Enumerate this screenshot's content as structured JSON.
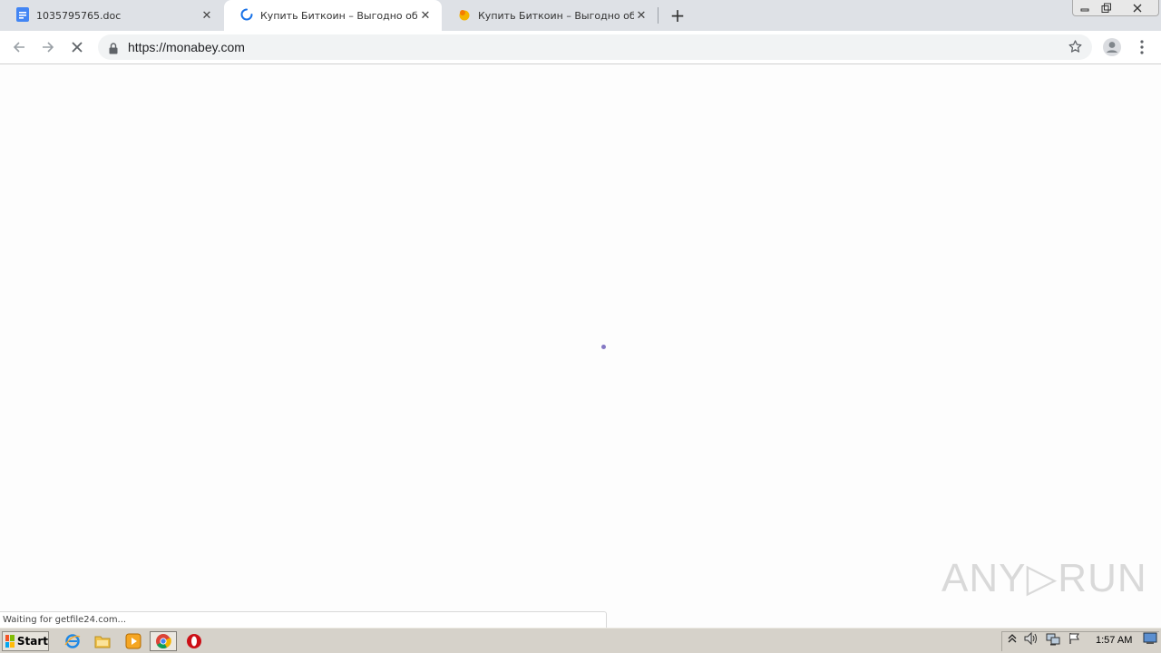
{
  "browser": {
    "tabs": [
      {
        "title": "1035795765.doc",
        "icon": "docs-icon",
        "active": false
      },
      {
        "title": "Купить Биткоин – Выгодно обмен",
        "icon": "loading-spinner-icon",
        "active": true
      },
      {
        "title": "Купить Биткоин – Выгодно обмен",
        "icon": "site-favicon-icon",
        "active": false
      }
    ],
    "new_tab_label": "+",
    "address": {
      "url": "https://monabey.com"
    },
    "status_text": "Waiting for getfile24.com..."
  },
  "content": {
    "loading": true,
    "watermark": "ANY▷RUN"
  },
  "taskbar": {
    "start_label": "Start",
    "pinned": [
      "ie-icon",
      "explorer-icon",
      "media-player-icon",
      "chrome-icon",
      "opera-icon"
    ],
    "tray": [
      "show-hidden-icon",
      "volume-icon",
      "network-icon",
      "action-center-flag-icon",
      "show-desktop-icon"
    ],
    "clock": "1:57 AM"
  },
  "colors": {
    "tabstrip": "#dee1e6",
    "omnibox": "#f1f3f4",
    "spinner": "#8478c4",
    "taskbar": "#d6d2ca"
  }
}
